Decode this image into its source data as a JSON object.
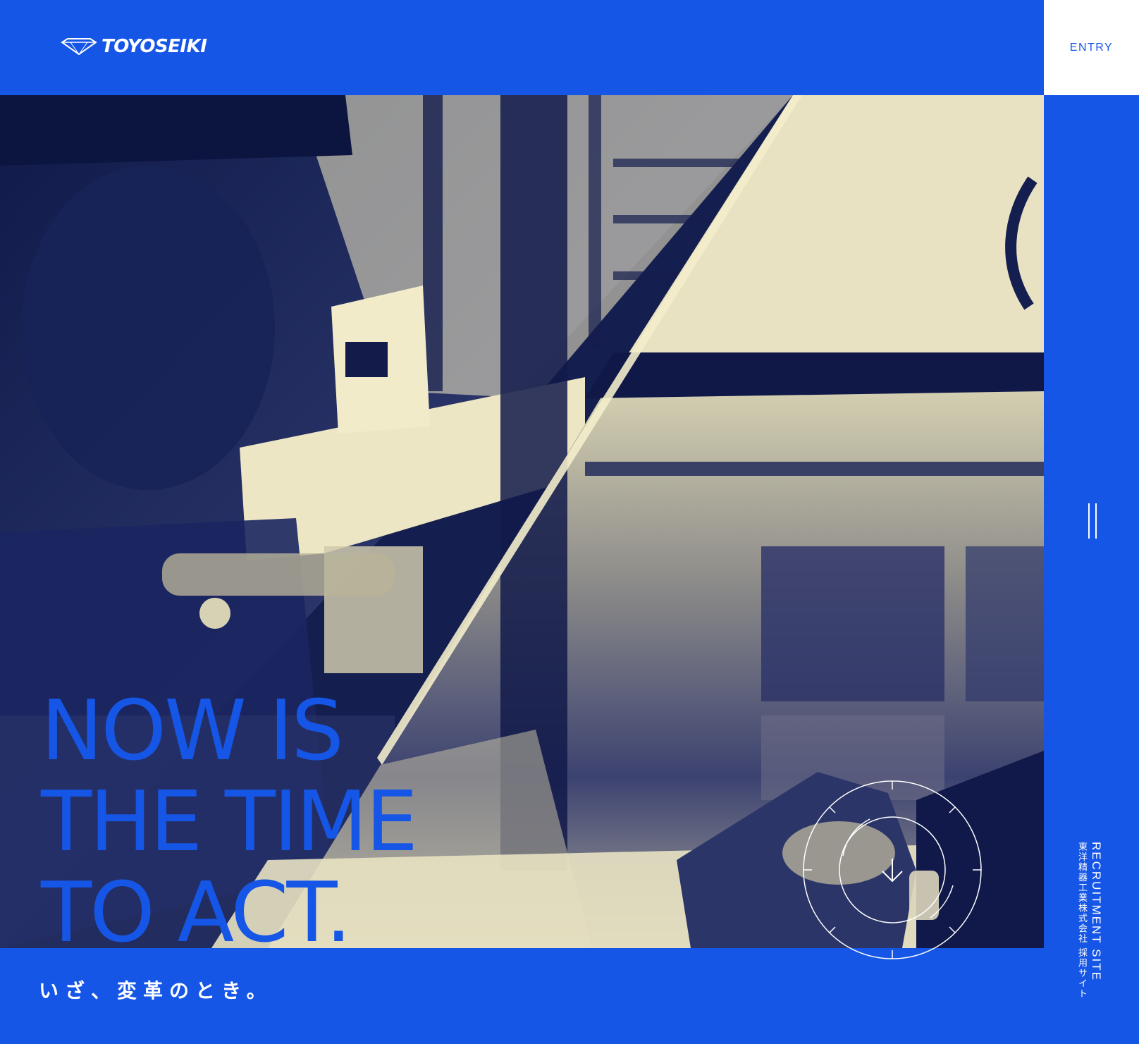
{
  "header": {
    "brand": "TOYOSEIKI",
    "logo_badge": "Dragon"
  },
  "entry_label": "ENTRY",
  "hero": {
    "headline": [
      "NOW IS",
      "THE TIME",
      "TO ACT."
    ],
    "subcopy": "いざ、変革のとき。"
  },
  "side": {
    "label_en": "RECRUITMENT SITE",
    "label_jp": "東洋精器工業株式会社 採用サイト"
  },
  "icons": {
    "menu": "hamburger-vertical-icon",
    "scroll": "arrow-down-icon"
  },
  "colors": {
    "brand_blue": "#1656e6",
    "duotone_dark": "#151f4f",
    "duotone_light": "#f2ecc8",
    "white": "#ffffff"
  }
}
